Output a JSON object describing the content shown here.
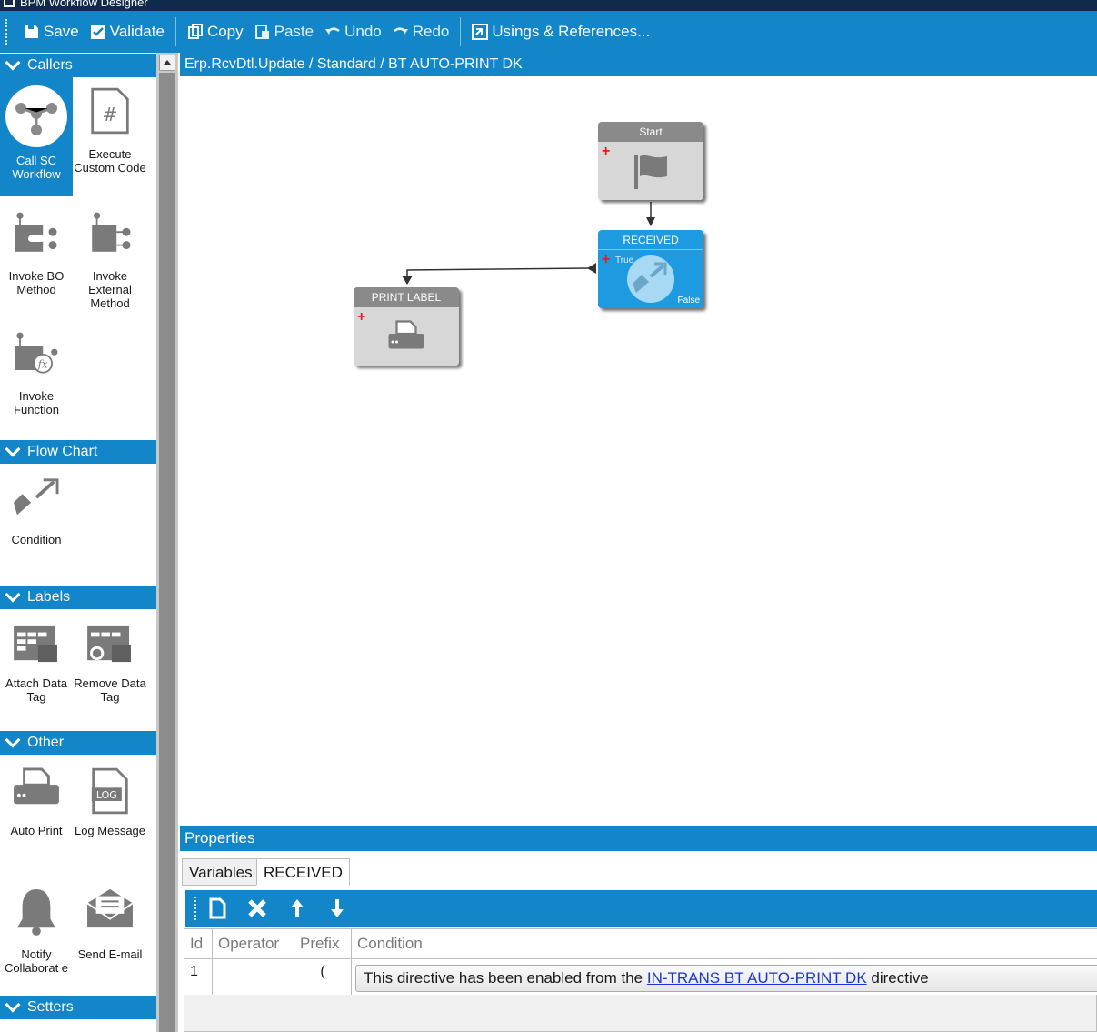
{
  "window": {
    "title": "BPM Workflow Designer"
  },
  "toolbar": {
    "save": "Save",
    "validate": "Validate",
    "copy": "Copy",
    "paste": "Paste",
    "undo": "Undo",
    "redo": "Redo",
    "usings": "Usings & References..."
  },
  "palette": {
    "callers": {
      "title": "Callers",
      "items": [
        {
          "label": "Call SC Workflow",
          "icon": "workflow-icon"
        },
        {
          "label": "Execute Custom Code",
          "icon": "code-file-icon"
        },
        {
          "label": "Invoke BO Method",
          "icon": "bo-method-icon"
        },
        {
          "label": "Invoke External Method",
          "icon": "external-method-icon"
        },
        {
          "label": "Invoke Function",
          "icon": "function-icon"
        }
      ]
    },
    "flowchart": {
      "title": "Flow Chart",
      "items": [
        {
          "label": "Condition",
          "icon": "condition-icon"
        }
      ]
    },
    "labels": {
      "title": "Labels",
      "items": [
        {
          "label": "Attach Data Tag",
          "icon": "attach-tag-icon"
        },
        {
          "label": "Remove Data Tag",
          "icon": "remove-tag-icon"
        }
      ]
    },
    "other": {
      "title": "Other",
      "items": [
        {
          "label": "Auto Print",
          "icon": "printer-icon"
        },
        {
          "label": "Log Message",
          "icon": "log-icon"
        },
        {
          "label": "Notify Collaborat e",
          "icon": "bell-icon"
        },
        {
          "label": "Send E-mail",
          "icon": "envelope-icon"
        }
      ]
    },
    "setters": {
      "title": "Setters"
    }
  },
  "canvas": {
    "breadcrumb": "Erp.RcvDtl.Update / Standard / BT AUTO-PRINT DK",
    "nodes": {
      "start": {
        "title": "Start"
      },
      "received": {
        "title": "RECEIVED",
        "true_label": "True",
        "false_label": "False"
      },
      "print": {
        "title": "PRINT LABEL"
      }
    }
  },
  "properties": {
    "title": "Properties",
    "tabs": [
      "Variables",
      "RECEIVED"
    ],
    "grid": {
      "columns": [
        "Id",
        "Operator",
        "Prefix",
        "Condition"
      ],
      "rows": [
        {
          "id": "1",
          "operator": "",
          "prefix": "(",
          "condition_before": "This directive has been enabled from the ",
          "condition_link": "IN-TRANS BT AUTO-PRINT DK",
          "condition_after": " directive"
        }
      ]
    }
  },
  "colors": {
    "accent": "#1386c9",
    "active_node": "#1e9be0",
    "node_header": "#8a8a8a",
    "node_body": "#d7d7d7"
  }
}
